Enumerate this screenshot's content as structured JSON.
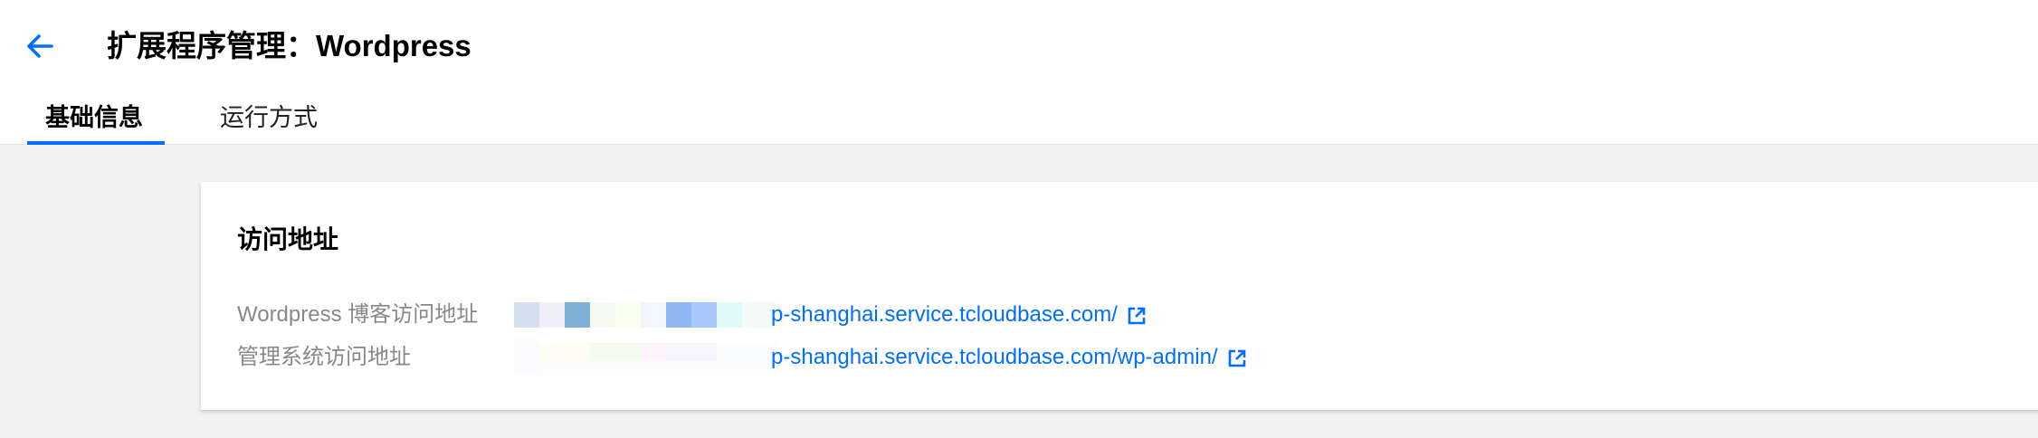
{
  "header": {
    "title": "扩展程序管理：Wordpress",
    "back_icon": "arrow-left-icon"
  },
  "tabs": [
    {
      "label": "基础信息",
      "active": true
    },
    {
      "label": "运行方式",
      "active": false
    }
  ],
  "card": {
    "title": "访问地址",
    "rows": [
      {
        "label": "Wordpress 博客访问地址",
        "link": "p-shanghai.service.tcloudbase.com/"
      },
      {
        "label": "管理系统访问地址",
        "link": "p-shanghai.service.tcloudbase.com/wp-admin/"
      }
    ]
  },
  "colors": {
    "accent": "#006eff",
    "background": "#f2f2f2",
    "label": "#888888"
  }
}
